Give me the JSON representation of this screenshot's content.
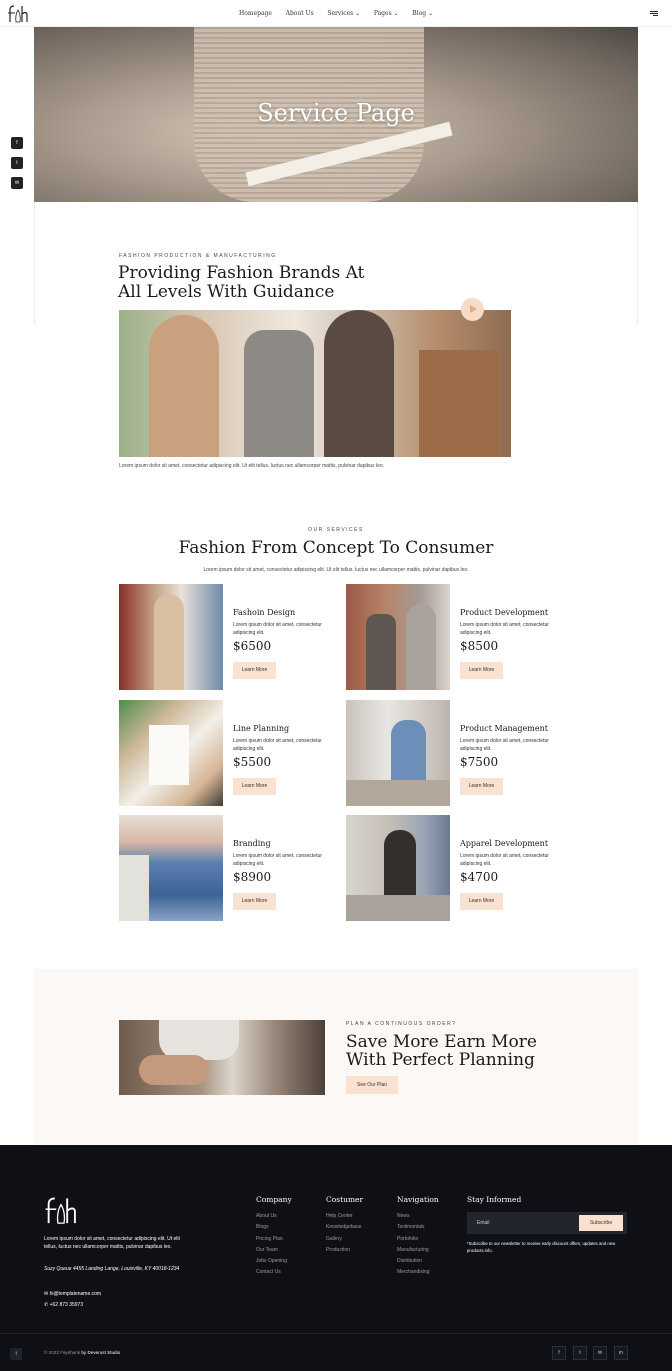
{
  "header": {
    "nav": [
      "Homepage",
      "About Us",
      "Services ⌄",
      "Pages ⌄",
      "Blog ⌄"
    ]
  },
  "social_rail": [
    "f",
    "t",
    "✉"
  ],
  "hero": {
    "title": "Service Page"
  },
  "intro": {
    "eyebrow": "Fashion Production & Manufacturing",
    "title_line1": "Providing Fashion Brands At",
    "title_line2": "All Levels With Guidance",
    "caption": "Lorem ipsum dolor sit amet, consectetur adipiscing elit. Ut elit tellus, luctus nec ullamcorper mattis, pulvinar dapibus leo."
  },
  "services": {
    "eyebrow": "Our Services",
    "title": "Fashion From Concept To Consumer",
    "subtitle": "Lorem ipsum dolor sit amet, consectetur adipiscing elit. Ut elit tellus, luctus nec ullamcorper mattis, pulvinar dapibus leo.",
    "items": [
      {
        "title": "Fashoin Design",
        "desc": "Lorem ipsum dolor sit amet, consectetur adipiscing elit.",
        "price": "$6500",
        "button": "Learn More"
      },
      {
        "title": "Product Development",
        "desc": "Lorem ipsum dolor sit amet, consectetur adipiscing elit.",
        "price": "$8500",
        "button": "Learn More"
      },
      {
        "title": "Line Planning",
        "desc": "Lorem ipsum dolor sit amet, consectetur adipiscing elit.",
        "price": "$5500",
        "button": "Learn More"
      },
      {
        "title": "Product Management",
        "desc": "Lorem ipsum dolor sit amet, consectetur adipiscing elit.",
        "price": "$7500",
        "button": "Learn More"
      },
      {
        "title": "Branding",
        "desc": "Lorem ipsum dolor sit amet, consectetur adipiscing elit.",
        "price": "$8900",
        "button": "Learn More"
      },
      {
        "title": "Apparel Development",
        "desc": "Lorem ipsum dolor sit amet, consectetur adipiscing elit.",
        "price": "$4700",
        "button": "Learn More"
      }
    ]
  },
  "plan": {
    "eyebrow": "Plan a continuous order?",
    "title_line1": "Save More Earn More",
    "title_line2": "With Perfect Planning",
    "button": "See Our Plan"
  },
  "footer": {
    "about": "Lorem ipsum dolor sit amet, consectetur adipiscing elit. Ut elit tellus, luctus nec ullamcorper mattis, pulvinar dapibus leo.",
    "address": "Suzy Queue 4455 Landing Lange, Louisville, KY 40018-1234",
    "email": "hi@templatename.com",
    "phone": "+62 873 35973",
    "columns": [
      {
        "title": "Company",
        "links": [
          "About Us",
          "Blogs",
          "Pricing Plan",
          "Our Team",
          "Jobs Opening",
          "Contact Us"
        ]
      },
      {
        "title": "Costumer",
        "links": [
          "Help Center",
          "Knowledgebase",
          "Gallery",
          "Production"
        ]
      },
      {
        "title": "Navigation",
        "links": [
          "News",
          "Testimonials",
          "Portofolio",
          "Manufacturing",
          "Distribution",
          "Merchandising"
        ]
      }
    ],
    "newsletter": {
      "title": "Stay Informed",
      "placeholder": "Email",
      "button": "Subscribe",
      "note": "*Subscribe to our newsletter to receive early discount offers, updates and new products info."
    },
    "copyright_prefix": "© 2022 Fayshans",
    "copyright_by": "by Deverust Studio",
    "social": [
      "f",
      "t",
      "✉",
      "in"
    ]
  },
  "colors": {
    "accent": "#fbe1cf",
    "footer_bg": "#0e1016",
    "plan_bg": "#fbf8f5"
  }
}
